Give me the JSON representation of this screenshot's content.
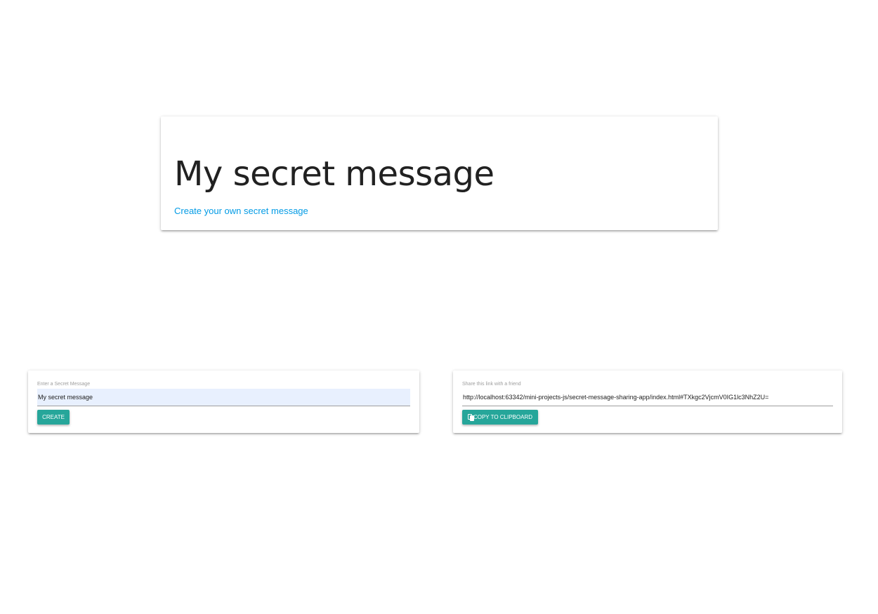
{
  "message_display": {
    "heading": "My secret message",
    "create_link": "Create your own secret message"
  },
  "create_form": {
    "label": "Enter a Secret Message",
    "value": "My secret message",
    "button_label": "CREATE"
  },
  "share_link": {
    "label": "Share this link with a friend",
    "value": "http://localhost:63342/mini-projects-js/secret-message-sharing-app/index.html#TXkgc2VjcmV0IG1lc3NhZ2U=",
    "button_label": "COPY TO CLIPBOARD",
    "button_icon": "copy-icon"
  },
  "colors": {
    "accent_button": "#26a69a",
    "link": "#039be5",
    "autofill_bg": "#e8f0fe"
  }
}
